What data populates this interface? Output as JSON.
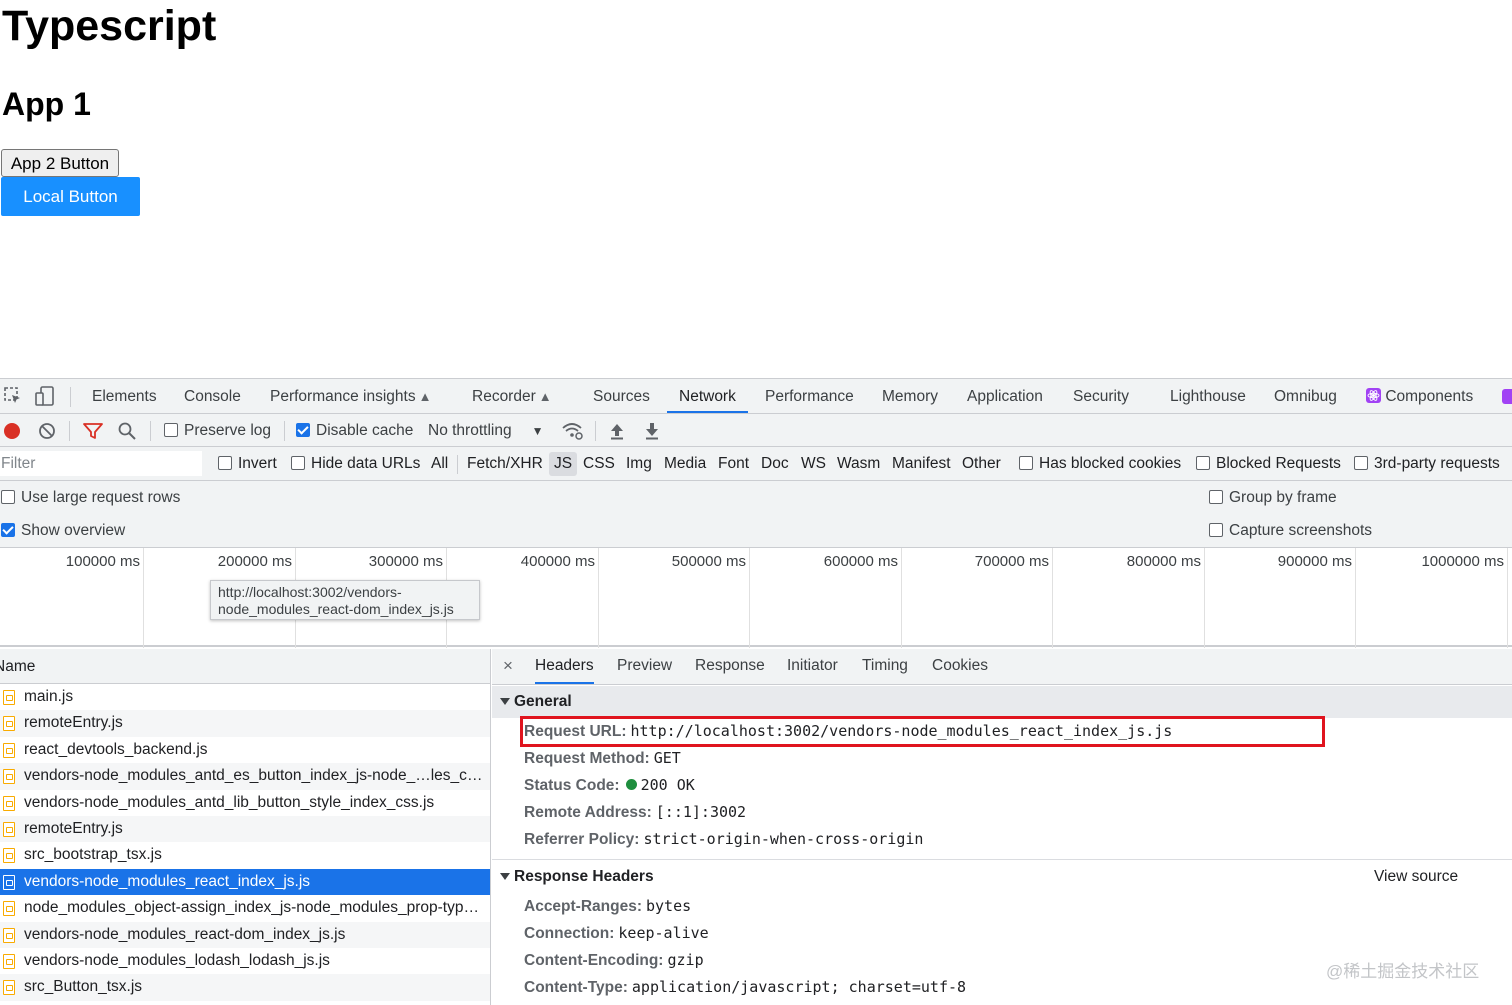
{
  "page": {
    "title": "Typescript",
    "subtitle": "App 1",
    "app2_button": "App 2 Button",
    "local_button": "Local Button"
  },
  "devtools": {
    "tabs": [
      "Elements",
      "Console",
      "Performance insights",
      "Recorder",
      "Sources",
      "Network",
      "Performance",
      "Memory",
      "Application",
      "Security",
      "Lighthouse",
      "Omnibug",
      "Components"
    ],
    "active_tab": "Network",
    "toolbar": {
      "preserve_log": "Preserve log",
      "preserve_log_checked": false,
      "disable_cache": "Disable cache",
      "disable_cache_checked": true,
      "throttling": "No throttling"
    },
    "filter": {
      "placeholder": "Filter",
      "invert": "Invert",
      "hide_data_urls": "Hide data URLs",
      "types": [
        "All",
        "Fetch/XHR",
        "JS",
        "CSS",
        "Img",
        "Media",
        "Font",
        "Doc",
        "WS",
        "Wasm",
        "Manifest",
        "Other"
      ],
      "active_type": "JS",
      "has_blocked_cookies": "Has blocked cookies",
      "blocked_requests": "Blocked Requests",
      "third_party": "3rd-party requests"
    },
    "options": {
      "large_rows": "Use large request rows",
      "large_rows_checked": false,
      "show_overview": "Show overview",
      "show_overview_checked": true,
      "group_by_frame": "Group by frame",
      "group_by_frame_checked": false,
      "capture_screenshots": "Capture screenshots",
      "capture_screenshots_checked": false
    },
    "overview_ticks": [
      "100000 ms",
      "200000 ms",
      "300000 ms",
      "400000 ms",
      "500000 ms",
      "600000 ms",
      "700000 ms",
      "800000 ms",
      "900000 ms",
      "1000000 ms"
    ],
    "request_list": {
      "header": "Name",
      "rows": [
        "main.js",
        "remoteEntry.js",
        "react_devtools_backend.js",
        "vendors-node_modules_antd_es_button_index_js-node_…les_cs…",
        "vendors-node_modules_antd_lib_button_style_index_css.js",
        "remoteEntry.js",
        "src_bootstrap_tsx.js",
        "vendors-node_modules_react_index_js.js",
        "node_modules_object-assign_index_js-node_modules_prop-type…",
        "vendors-node_modules_react-dom_index_js.js",
        "vendors-node_modules_lodash_lodash_js.js",
        "src_Button_tsx.js"
      ],
      "selected_index": 7,
      "tooltip_line1": "http://localhost:3002/vendors-",
      "tooltip_line2": "node_modules_react-dom_index_js.js"
    },
    "details": {
      "close": "×",
      "tabs": [
        "Headers",
        "Preview",
        "Response",
        "Initiator",
        "Timing",
        "Cookies"
      ],
      "active_tab": "Headers",
      "general_title": "General",
      "general": [
        {
          "key": "Request URL:",
          "value": "http://localhost:3002/vendors-node_modules_react_index_js.js"
        },
        {
          "key": "Request Method:",
          "value": "GET"
        },
        {
          "key": "Status Code:",
          "value": "200 OK"
        },
        {
          "key": "Remote Address:",
          "value": "[::1]:3002"
        },
        {
          "key": "Referrer Policy:",
          "value": "strict-origin-when-cross-origin"
        }
      ],
      "response_headers_title": "Response Headers",
      "view_source": "View source",
      "response_headers": [
        {
          "key": "Accept-Ranges:",
          "value": "bytes"
        },
        {
          "key": "Connection:",
          "value": "keep-alive"
        },
        {
          "key": "Content-Encoding:",
          "value": "gzip"
        },
        {
          "key": "Content-Type:",
          "value": "application/javascript; charset=utf-8"
        }
      ]
    }
  },
  "watermark": "@稀土掘金技术社区",
  "colors": {
    "accent": "#1a73e8",
    "local_button": "#1890ff",
    "highlight_box": "#e0141e",
    "status_ok": "#1e8e3e",
    "file_icon": "#f9ab00"
  }
}
